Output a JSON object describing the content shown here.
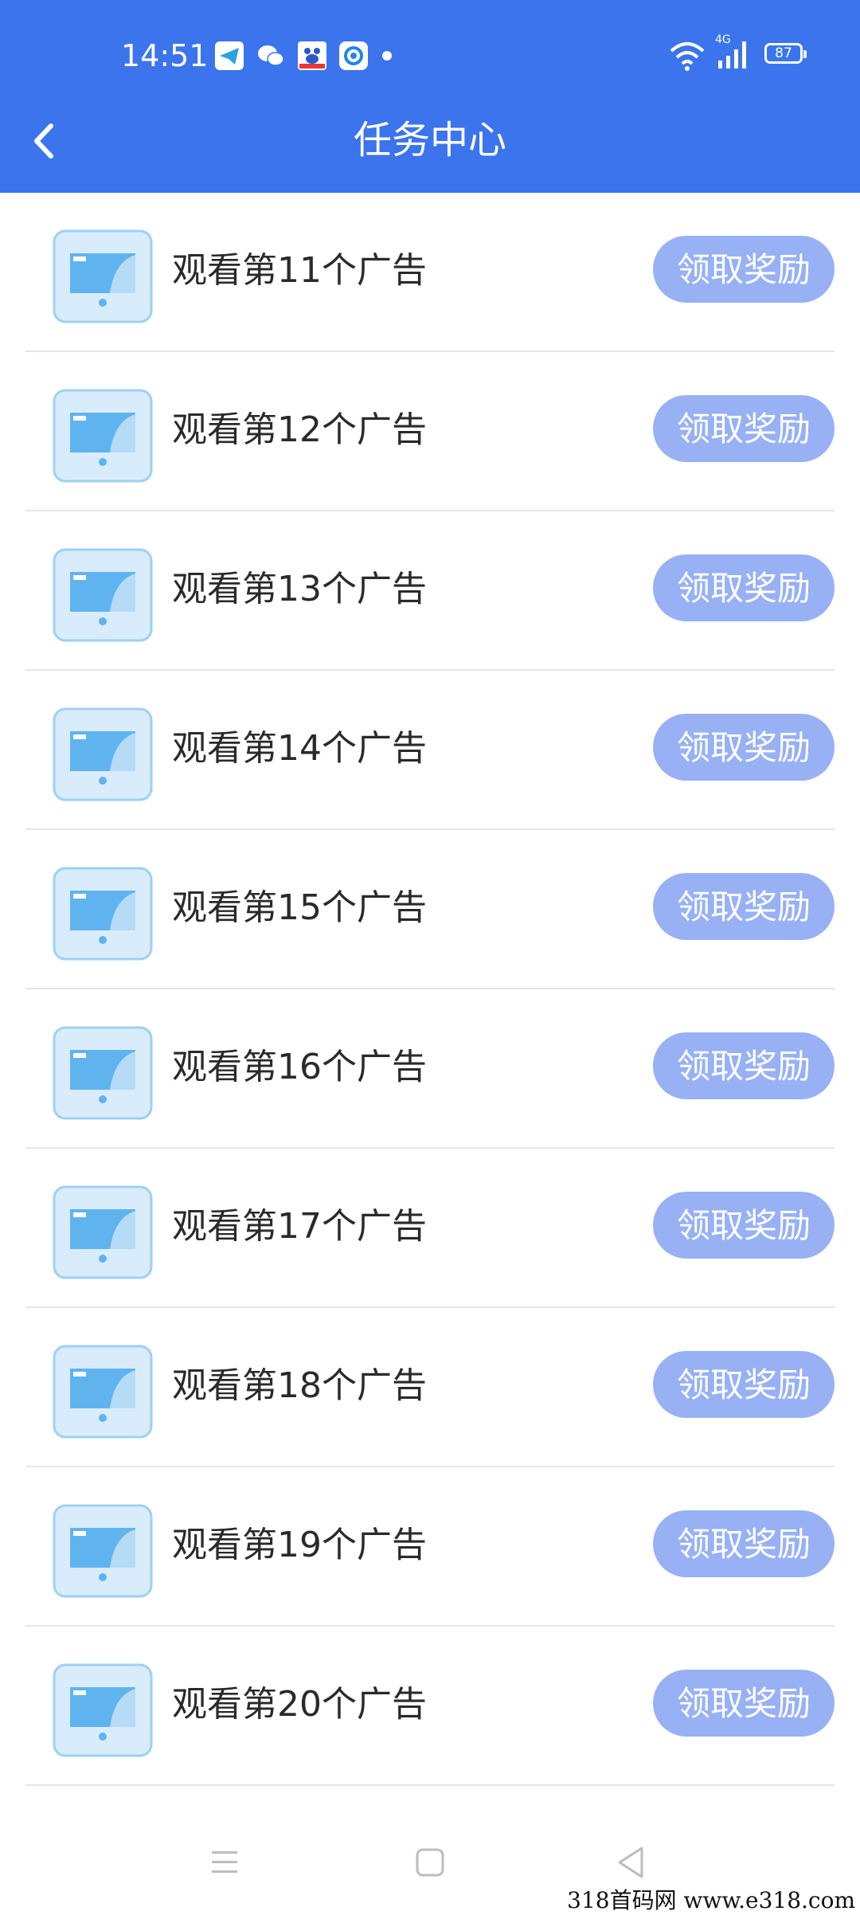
{
  "status_bar": {
    "time": "14:51",
    "battery": "87",
    "network": "4G"
  },
  "header": {
    "title": "任务中心"
  },
  "tasks": [
    {
      "label": "观看第11个广告",
      "button": "领取奖励"
    },
    {
      "label": "观看第12个广告",
      "button": "领取奖励"
    },
    {
      "label": "观看第13个广告",
      "button": "领取奖励"
    },
    {
      "label": "观看第14个广告",
      "button": "领取奖励"
    },
    {
      "label": "观看第15个广告",
      "button": "领取奖励"
    },
    {
      "label": "观看第16个广告",
      "button": "领取奖励"
    },
    {
      "label": "观看第17个广告",
      "button": "领取奖励"
    },
    {
      "label": "观看第18个广告",
      "button": "领取奖励"
    },
    {
      "label": "观看第19个广告",
      "button": "领取奖励"
    },
    {
      "label": "观看第20个广告",
      "button": "领取奖励"
    }
  ],
  "watermark": "318首码网  www.e318.com",
  "colors": {
    "header": "#3b74ec",
    "button": "#97b1f4"
  }
}
